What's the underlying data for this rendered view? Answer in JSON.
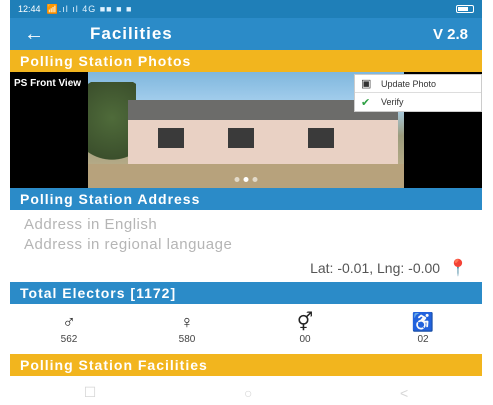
{
  "status_bar": {
    "time": "12:44",
    "indicators": "📶.ıl ıl 4G ■■ ■ ■"
  },
  "app_bar": {
    "back_icon": "←",
    "title": "Facilities",
    "version": "V 2.8"
  },
  "photos_section": {
    "header": "Polling Station Photos",
    "photo_label": "PS Front View",
    "menu": {
      "update_label": "Update Photo",
      "verify_label": "Verify"
    }
  },
  "address_section": {
    "header": "Polling Station Address",
    "english_placeholder": "Address in English",
    "regional_placeholder": "Address in regional language",
    "lat_lng": "Lat: -0.01, Lng: -0.00"
  },
  "electors_section": {
    "header": "Total Electors [1172]",
    "items": [
      {
        "icon": "male-icon",
        "glyph": "♂",
        "value": "562"
      },
      {
        "icon": "female-icon",
        "glyph": "♀",
        "value": "580"
      },
      {
        "icon": "third-gender-icon",
        "glyph": "⚥",
        "value": "00"
      },
      {
        "icon": "wheelchair-icon",
        "glyph": "♿",
        "value": "02"
      }
    ]
  },
  "facilities_section": {
    "header": "Polling Station Facilities"
  },
  "nav_bar": {
    "recent": "☐",
    "home": "○",
    "back": "<"
  },
  "colors": {
    "primary_blue": "#2b8bc8",
    "status_blue": "#1f7fb8",
    "accent_yellow": "#f2b51e"
  }
}
